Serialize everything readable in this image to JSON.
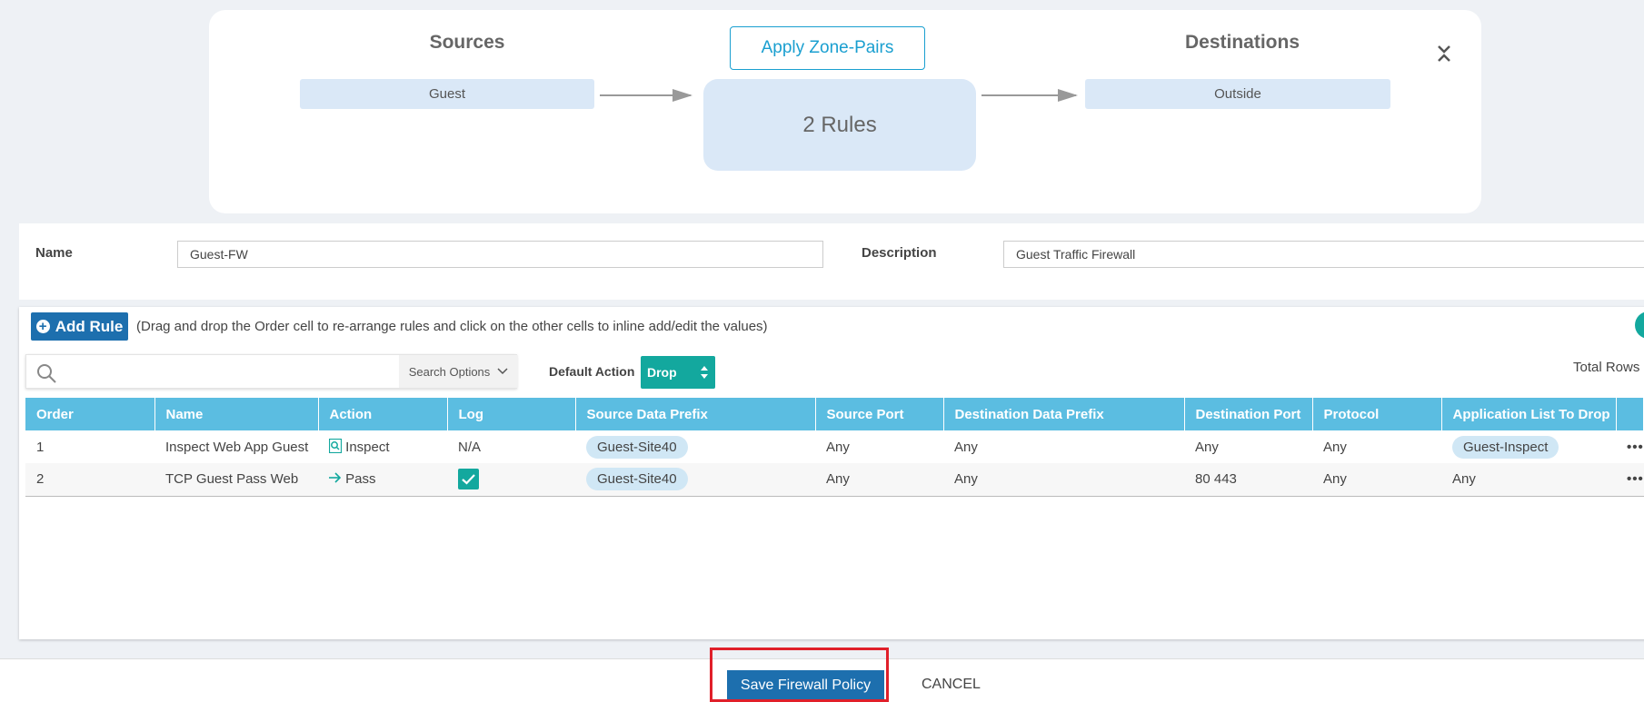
{
  "zone_pairs": {
    "sources_title": "Sources",
    "destinations_title": "Destinations",
    "apply_button": "Apply Zone-Pairs",
    "source_zone": "Guest",
    "rules_summary": "2 Rules",
    "destination_zone": "Outside"
  },
  "policy_form": {
    "name_label": "Name",
    "name_value": "Guest-FW",
    "description_label": "Description",
    "description_value": "Guest Traffic Firewall"
  },
  "rules_toolbar": {
    "add_rule_label": "Add Rule",
    "hint": "(Drag and drop the Order cell to re-arrange rules and click on the other cells to inline add/edit the values)",
    "search_placeholder": "",
    "search_options_label": "Search Options",
    "default_action_label": "Default Action",
    "default_action_value": "Drop",
    "total_rows_label": "Total Rows"
  },
  "rules_table": {
    "columns": [
      "Order",
      "Name",
      "Action",
      "Log",
      "Source Data Prefix",
      "Source Port",
      "Destination Data Prefix",
      "Destination Port",
      "Protocol",
      "Application List To Drop"
    ],
    "rows": [
      {
        "order": "1",
        "name": "Inspect Web App Guest",
        "action": "Inspect",
        "action_icon": "inspect-icon",
        "log": "N/A",
        "source_prefix": "Guest-Site40",
        "source_port": "Any",
        "dest_prefix": "Any",
        "dest_port": "Any",
        "protocol": "Any",
        "app_list": "Guest-Inspect",
        "more": "•••"
      },
      {
        "order": "2",
        "name": "TCP Guest Pass Web",
        "action": "Pass",
        "action_icon": "arrow-right-icon",
        "log": "checked",
        "source_prefix": "Guest-Site40",
        "source_port": "Any",
        "dest_prefix": "Any",
        "dest_port": "80 443",
        "protocol": "Any",
        "app_list": "Any",
        "more": "•••"
      }
    ]
  },
  "footer": {
    "save_label": "Save Firewall Policy",
    "cancel_label": "CANCEL"
  },
  "colors": {
    "header_blue": "#5bbde1",
    "primary_button": "#1d6fae",
    "teal": "#13a89e",
    "highlight_red": "#e0202a",
    "zone_fill": "#dae8f7"
  }
}
